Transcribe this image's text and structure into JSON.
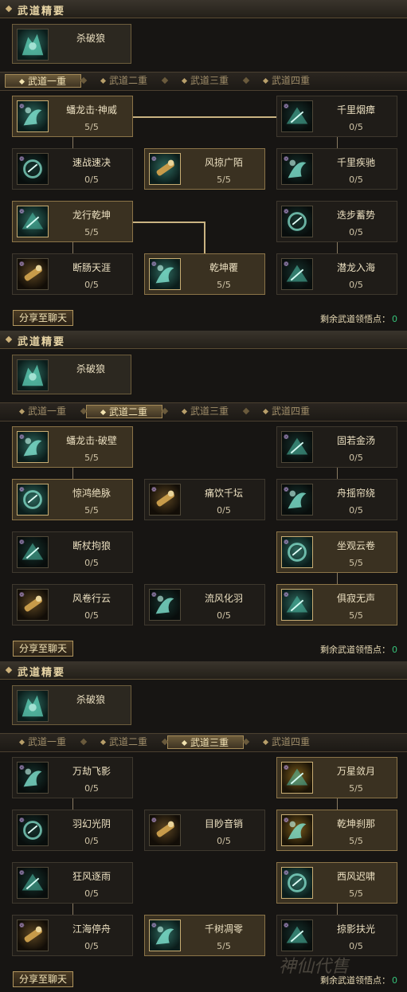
{
  "sections": [
    {
      "header_title": "武道精要",
      "core_skill": "杀破狼",
      "tabs": [
        "武道一重",
        "武道二重",
        "武道三重",
        "武道四重"
      ],
      "active_tab": 0,
      "nodes": [
        {
          "name": "蟠龙击·神威",
          "count": "5/5",
          "learned": true,
          "icon": "dragon-strike-icon"
        },
        {
          "name": "千里烟瘴",
          "count": "0/5",
          "learned": false,
          "icon": "mist-icon"
        },
        {
          "name": "速战速决",
          "count": "0/5",
          "learned": false,
          "icon": "swift-battle-icon"
        },
        {
          "name": "风掠广陌",
          "count": "5/5",
          "learned": true,
          "icon": "wind-sweep-icon"
        },
        {
          "name": "千里疾驰",
          "count": "0/5",
          "learned": false,
          "icon": "gallop-icon"
        },
        {
          "name": "龙行乾坤",
          "count": "5/5",
          "learned": true,
          "icon": "dragon-walk-icon"
        },
        {
          "name": "迭步蓄势",
          "count": "0/5",
          "learned": false,
          "icon": "step-charge-icon"
        },
        {
          "name": "断肠天涯",
          "count": "0/5",
          "learned": false,
          "icon": "broken-heart-icon"
        },
        {
          "name": "乾坤覆",
          "count": "5/5",
          "learned": true,
          "icon": "heaven-cover-icon"
        },
        {
          "name": "潜龙入海",
          "count": "0/5",
          "learned": false,
          "icon": "hidden-dragon-icon"
        }
      ],
      "share_label": "分享至聊天",
      "points_label": "剩余武道领悟点：",
      "points_value": "0"
    },
    {
      "header_title": "武道精要",
      "core_skill": "杀破狼",
      "tabs": [
        "武道一重",
        "武道二重",
        "武道三重",
        "武道四重"
      ],
      "active_tab": 1,
      "nodes": [
        {
          "name": "蟠龙击·破壁",
          "count": "5/5",
          "learned": true,
          "icon": "dragon-strike-icon"
        },
        {
          "name": "固若金汤",
          "count": "0/5",
          "learned": false,
          "icon": "iron-wall-icon"
        },
        {
          "name": "惊鸿绝脉",
          "count": "5/5",
          "learned": true,
          "icon": "startle-pulse-icon"
        },
        {
          "name": "痛饮千坛",
          "count": "0/5",
          "learned": false,
          "icon": "drink-icon"
        },
        {
          "name": "舟摇帘绕",
          "count": "0/5",
          "learned": false,
          "icon": "boat-icon"
        },
        {
          "name": "断杖拘狼",
          "count": "0/5",
          "learned": false,
          "icon": "broken-staff-icon"
        },
        {
          "name": "坐观云卷",
          "count": "5/5",
          "learned": true,
          "icon": "cloud-watch-icon"
        },
        {
          "name": "风卷行云",
          "count": "0/5",
          "learned": false,
          "icon": "wind-cloud-icon"
        },
        {
          "name": "流风化羽",
          "count": "0/5",
          "learned": false,
          "icon": "feather-icon"
        },
        {
          "name": "俱寂无声",
          "count": "5/5",
          "learned": true,
          "icon": "silence-icon"
        }
      ],
      "share_label": "分享至聊天",
      "points_label": "剩余武道领悟点：",
      "points_value": "0"
    },
    {
      "header_title": "武道精要",
      "core_skill": "杀破狼",
      "tabs": [
        "武道一重",
        "武道二重",
        "武道三重",
        "武道四重"
      ],
      "active_tab": 2,
      "nodes": [
        {
          "name": "万劫飞影",
          "count": "0/5",
          "learned": false,
          "icon": "flying-shadow-icon"
        },
        {
          "name": "万星敛月",
          "count": "5/5",
          "learned": true,
          "icon": "star-moon-icon"
        },
        {
          "name": "羽幻光阴",
          "count": "0/5",
          "learned": false,
          "icon": "time-illusion-icon"
        },
        {
          "name": "目眇音销",
          "count": "0/5",
          "learned": false,
          "icon": "blind-sound-icon"
        },
        {
          "name": "乾坤刹那",
          "count": "5/5",
          "learned": true,
          "icon": "instant-icon"
        },
        {
          "name": "狂风逐雨",
          "count": "0/5",
          "learned": false,
          "icon": "storm-icon"
        },
        {
          "name": "西风迟啸",
          "count": "5/5",
          "learned": true,
          "icon": "west-wind-icon"
        },
        {
          "name": "江海停舟",
          "count": "0/5",
          "learned": false,
          "icon": "river-boat-icon"
        },
        {
          "name": "千树凋零",
          "count": "5/5",
          "learned": true,
          "icon": "withered-tree-icon"
        },
        {
          "name": "掠影扶光",
          "count": "0/5",
          "learned": false,
          "icon": "shadow-light-icon"
        }
      ],
      "share_label": "分享至聊天",
      "points_label": "剩余武道领悟点：",
      "points_value": "0"
    }
  ],
  "watermark_text": "神仙代售"
}
